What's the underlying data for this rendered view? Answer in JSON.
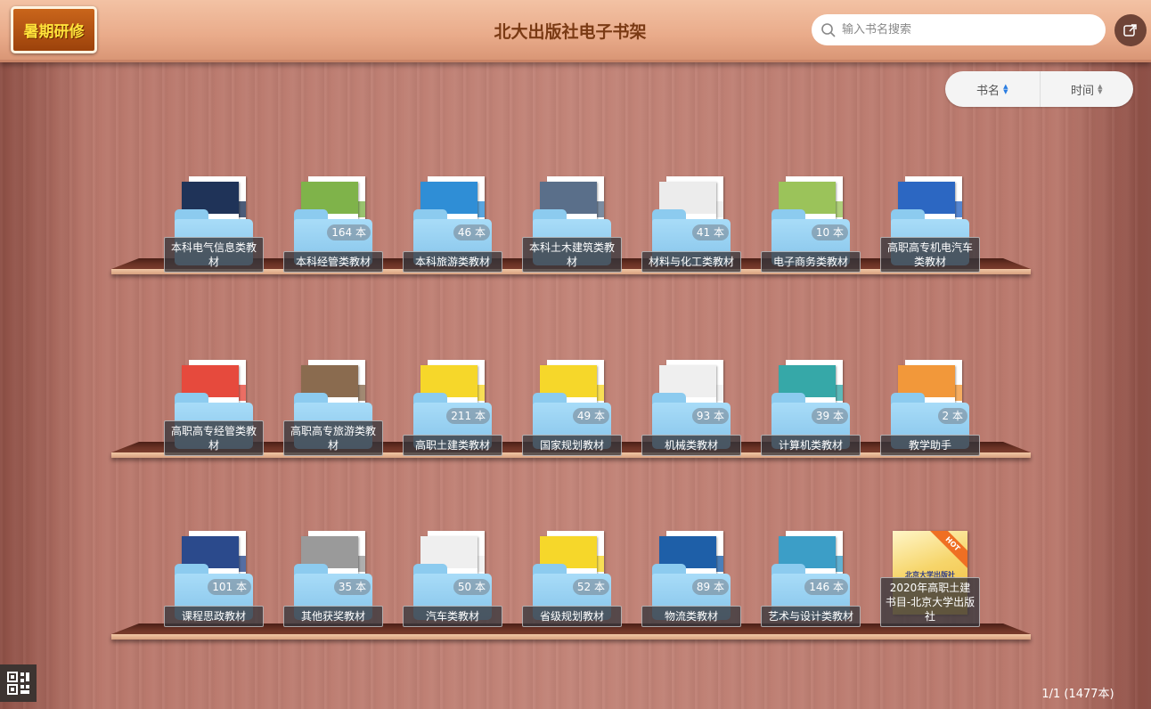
{
  "header": {
    "logo_text": "暑期研修",
    "title": "北大出版社电子书架",
    "search_placeholder": "输入书名搜索"
  },
  "sort": {
    "name_label": "书名",
    "time_label": "时间"
  },
  "shelves": [
    [
      {
        "label": "本科电气信息类教材",
        "count": "",
        "cover": "#1f3358"
      },
      {
        "label": "本科经管类教材",
        "count": "164 本",
        "cover": "#7fb34a"
      },
      {
        "label": "本科旅游类教材",
        "count": "46 本",
        "cover": "#2f8ed6"
      },
      {
        "label": "本科土木建筑类教材",
        "count": "",
        "cover": "#5a6f8a"
      },
      {
        "label": "材料与化工类教材",
        "count": "41 本",
        "cover": "#ececec"
      },
      {
        "label": "电子商务类教材",
        "count": "10 本",
        "cover": "#9bc35a"
      },
      {
        "label": "高职高专机电汽车类教材",
        "count": "",
        "cover": "#2c67c2"
      }
    ],
    [
      {
        "label": "高职高专经管类教材",
        "count": "",
        "cover": "#e64a3d"
      },
      {
        "label": "高职高专旅游类教材",
        "count": "",
        "cover": "#8a6b4f"
      },
      {
        "label": "高职土建类教材",
        "count": "211 本",
        "cover": "#f6d72a"
      },
      {
        "label": "国家规划教材",
        "count": "49 本",
        "cover": "#f6d72a"
      },
      {
        "label": "机械类教材",
        "count": "93 本",
        "cover": "#efefef"
      },
      {
        "label": "计算机类教材",
        "count": "39 本",
        "cover": "#36a8a8"
      },
      {
        "label": "教学助手",
        "count": "2 本",
        "cover": "#f2983a"
      }
    ],
    [
      {
        "label": "课程思政教材",
        "count": "101 本",
        "cover": "#2b4a8c"
      },
      {
        "label": "其他获奖教材",
        "count": "35 本",
        "cover": "#9a9a9a"
      },
      {
        "label": "汽车类教材",
        "count": "50 本",
        "cover": "#efefef"
      },
      {
        "label": "省级规划教材",
        "count": "52 本",
        "cover": "#f6d72a"
      },
      {
        "label": "物流类教材",
        "count": "89 本",
        "cover": "#1e5fa8"
      },
      {
        "label": "艺术与设计类教材",
        "count": "146 本",
        "cover": "#3c9ec7"
      },
      {
        "label": "2020年高职土建书目-北京大学出版社",
        "count": "",
        "cover": "#f6d56a",
        "special": true,
        "ribbon": "HOT",
        "cover_text": "北京大学出版社"
      }
    ]
  ],
  "pager": "1/1 (1477本)"
}
